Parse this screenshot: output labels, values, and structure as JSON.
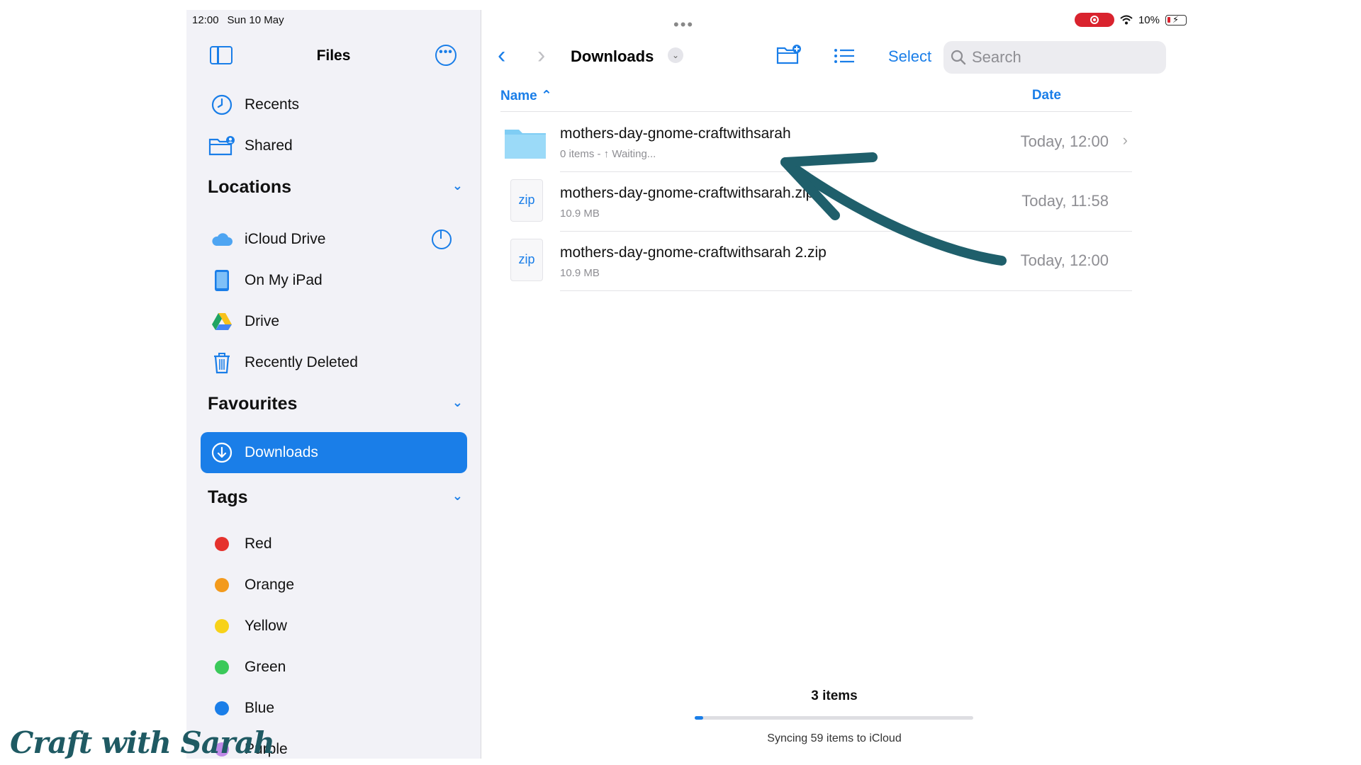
{
  "status": {
    "time": "12:00",
    "date": "Sun 10 May",
    "battery": "10%"
  },
  "sidebar": {
    "title": "Files",
    "top_items": [
      {
        "label": "Recents",
        "icon": "clock-icon"
      },
      {
        "label": "Shared",
        "icon": "shared-folder-icon"
      }
    ],
    "locations_title": "Locations",
    "locations": [
      {
        "label": "iCloud Drive",
        "icon": "icloud-icon"
      },
      {
        "label": "On My iPad",
        "icon": "ipad-icon"
      },
      {
        "label": "Drive",
        "icon": "google-drive-icon"
      },
      {
        "label": "Recently Deleted",
        "icon": "trash-icon"
      }
    ],
    "favourites_title": "Favourites",
    "favourites": [
      {
        "label": "Downloads",
        "icon": "download-circle-icon",
        "active": true
      }
    ],
    "tags_title": "Tags",
    "tags": [
      {
        "label": "Red",
        "color": "#e5322d"
      },
      {
        "label": "Orange",
        "color": "#f39a1c"
      },
      {
        "label": "Yellow",
        "color": "#f7d21a"
      },
      {
        "label": "Green",
        "color": "#3bc95a"
      },
      {
        "label": "Blue",
        "color": "#1a7ee8"
      },
      {
        "label": "Purple",
        "color": "#c08ae8"
      }
    ]
  },
  "main": {
    "title": "Downloads",
    "select_label": "Select",
    "search_placeholder": "Search",
    "columns": {
      "name": "Name",
      "date": "Date"
    },
    "files": [
      {
        "name": "mothers-day-gnome-craftwithsarah",
        "meta": "0 items - ↑ Waiting...",
        "date": "Today, 12:00",
        "type": "folder"
      },
      {
        "name": "mothers-day-gnome-craftwithsarah.zip",
        "meta": "10.9 MB",
        "date": "Today, 11:58",
        "type": "zip"
      },
      {
        "name": "mothers-day-gnome-craftwithsarah 2.zip",
        "meta": "10.9 MB",
        "date": "Today, 12:00",
        "type": "zip"
      }
    ],
    "zip_label": "zip",
    "footer": {
      "count": "3 items",
      "sync": "Syncing 59 items to iCloud",
      "progress": 0.03
    }
  },
  "brand": "Craft with Sarah",
  "colors": {
    "accent": "#1a7ee8",
    "arrow": "#1f5f6b",
    "sidebar_bg": "#f2f2f7"
  }
}
